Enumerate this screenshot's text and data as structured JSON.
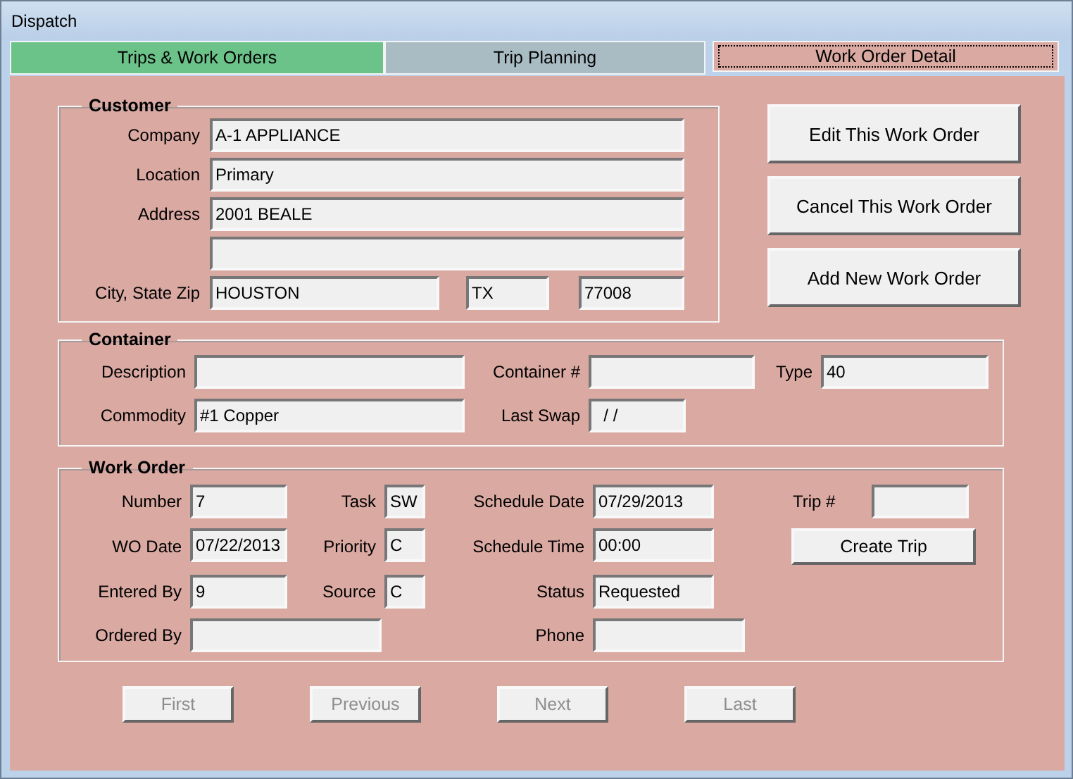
{
  "window": {
    "title": "Dispatch"
  },
  "tabs": [
    {
      "label": "Trips & Work Orders",
      "selected": false,
      "color": "#6cc38a"
    },
    {
      "label": "Trip Planning",
      "selected": false,
      "color": "#a9bcc4"
    },
    {
      "label": "Work Order Detail",
      "selected": true,
      "color": "#d9a9a2"
    }
  ],
  "customer": {
    "title": "Customer",
    "company": {
      "label": "Company",
      "value": "A-1 APPLIANCE"
    },
    "location": {
      "label": "Location",
      "value": "Primary"
    },
    "address": {
      "label": "Address",
      "lines": [
        "2001 BEALE"
      ]
    },
    "city_state_zip": {
      "label": "City, State Zip",
      "city": "HOUSTON",
      "state": "TX",
      "zip": "77008"
    }
  },
  "actions": [
    "Edit This Work Order",
    "Cancel This Work Order",
    "Add New Work Order"
  ],
  "container": {
    "title": "Container",
    "description": {
      "label": "Description"
    },
    "container_no": {
      "label": "Container #"
    },
    "type": {
      "label": "Type",
      "value": "40"
    },
    "commodity": {
      "label": "Commodity",
      "value": "#1 Copper"
    },
    "last_swap": {
      "label": "Last Swap",
      "value": "  / /"
    }
  },
  "work_order": {
    "title": "Work Order",
    "number": {
      "label": "Number",
      "value": "7"
    },
    "task": {
      "label": "Task",
      "value": "SW"
    },
    "schedule_date": {
      "label": "Schedule Date",
      "value": "07/29/2013"
    },
    "trip_no": {
      "label": "Trip #"
    },
    "wo_date": {
      "label": "WO Date",
      "value": "07/22/2013"
    },
    "priority": {
      "label": "Priority",
      "value": "C"
    },
    "schedule_time": {
      "label": "Schedule Time",
      "value": "00:00"
    },
    "create_trip": "Create Trip",
    "entered_by": {
      "label": "Entered By",
      "value": "9"
    },
    "source": {
      "label": "Source",
      "value": "C"
    },
    "status": {
      "label": "Status",
      "value": "Requested"
    },
    "ordered_by": {
      "label": "Ordered By"
    },
    "phone": {
      "label": "Phone"
    }
  },
  "navigation": [
    {
      "label": "First",
      "disabled": true
    },
    {
      "label": "Previous",
      "disabled": true
    },
    {
      "label": "Next",
      "disabled": true
    },
    {
      "label": "Last",
      "disabled": true
    }
  ]
}
